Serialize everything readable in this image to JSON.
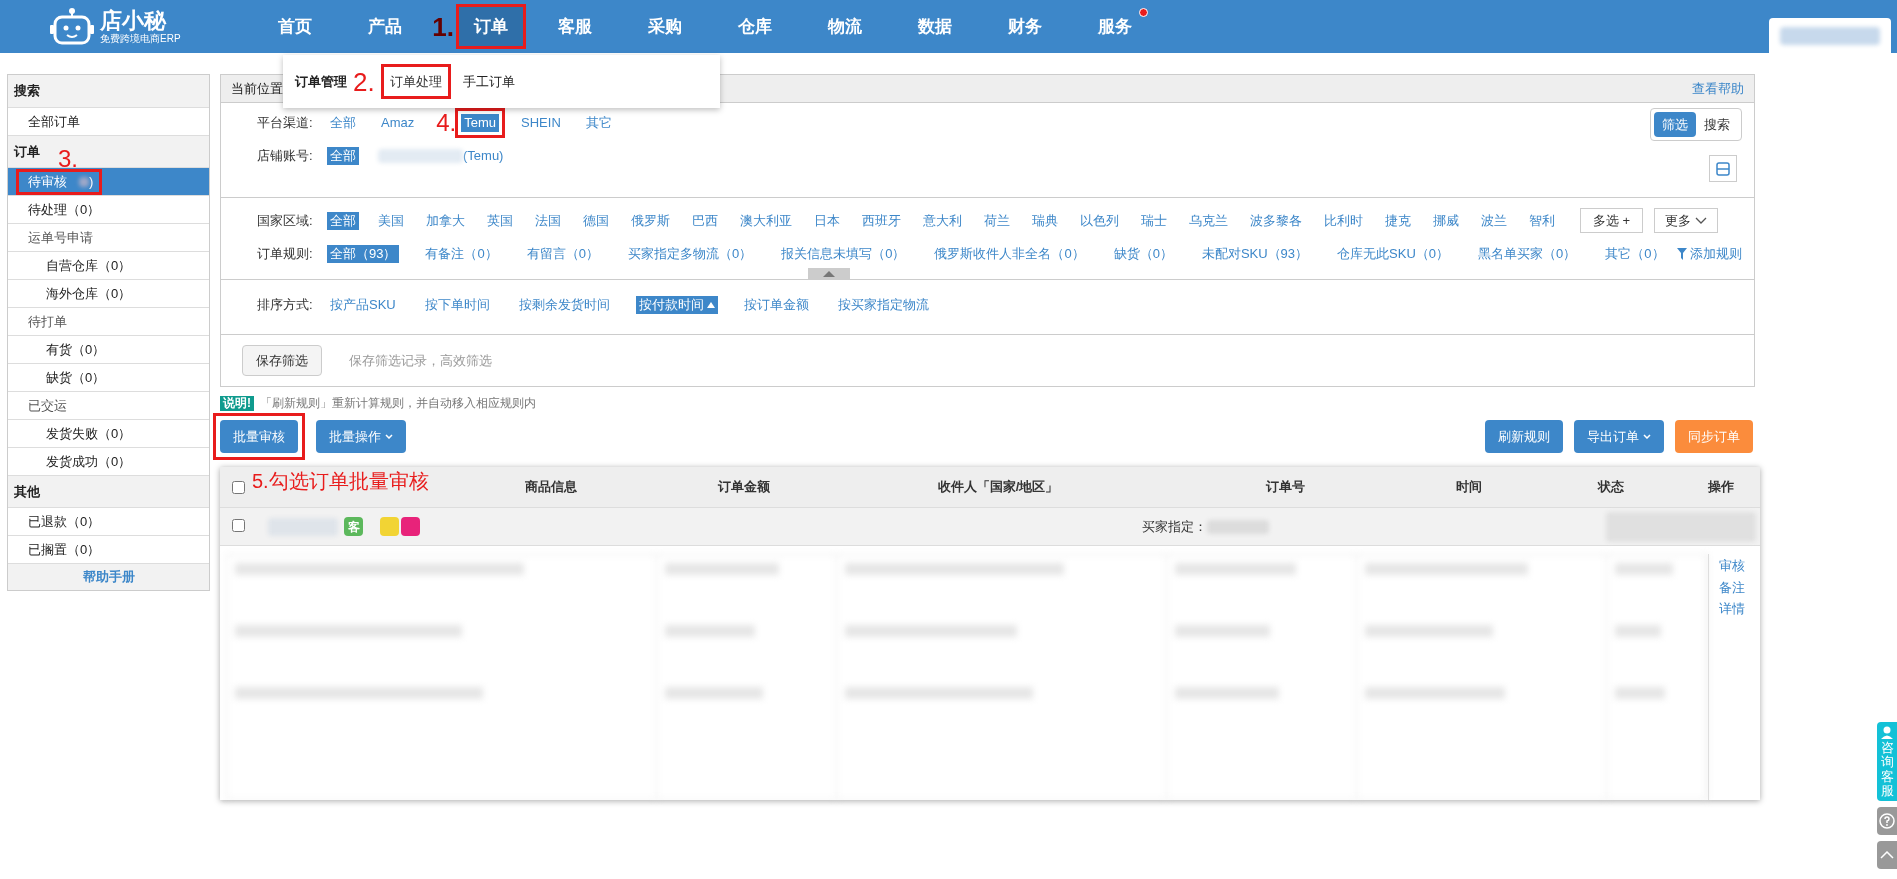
{
  "header": {
    "logo": {
      "name": "店小秘",
      "tagline": "免费跨境电商ERP"
    },
    "nav": [
      {
        "label": "首页",
        "selected": false,
        "dot": false
      },
      {
        "label": "产品",
        "selected": false,
        "dot": false
      },
      {
        "label": "订单",
        "selected": true,
        "dot": false,
        "annotation": "1."
      },
      {
        "label": "客服",
        "selected": false,
        "dot": false
      },
      {
        "label": "采购",
        "selected": false,
        "dot": false
      },
      {
        "label": "仓库",
        "selected": false,
        "dot": false
      },
      {
        "label": "物流",
        "selected": false,
        "dot": false
      },
      {
        "label": "数据",
        "selected": false,
        "dot": false
      },
      {
        "label": "财务",
        "selected": false,
        "dot": false
      },
      {
        "label": "服务",
        "selected": false,
        "dot": true
      }
    ]
  },
  "dropdown": {
    "title": "订单管理",
    "items": [
      {
        "label": "订单处理",
        "selected": true,
        "annotation": "2."
      },
      {
        "label": "手工订单",
        "selected": false
      }
    ]
  },
  "sidebar": {
    "sections": [
      {
        "title": "搜索",
        "items": [
          {
            "label": "全部订单",
            "selected": false
          }
        ]
      },
      {
        "title": "订单",
        "annotation": "3.",
        "items": [
          {
            "label": "待审核",
            "tail": ")",
            "count_hidden": true,
            "selected": true,
            "annotated": true
          },
          {
            "label": "待处理（0）",
            "selected": false
          },
          {
            "label": "运单号申请",
            "selected": false,
            "children": [
              {
                "label": "自营仓库（0）",
                "selected": false
              },
              {
                "label": "海外仓库（0）",
                "selected": false
              }
            ]
          },
          {
            "label": "待打单",
            "selected": false,
            "children": [
              {
                "label": "有货（0）",
                "selected": false
              },
              {
                "label": "缺货（0）",
                "selected": false
              }
            ]
          },
          {
            "label": "已交运",
            "selected": false,
            "children": [
              {
                "label": "发货失败（0）",
                "selected": false
              },
              {
                "label": "发货成功（0）",
                "selected": false
              }
            ]
          }
        ]
      },
      {
        "title": "其他",
        "items": [
          {
            "label": "已退款（0）",
            "selected": false
          },
          {
            "label": "已搁置（0）",
            "selected": false
          }
        ]
      }
    ],
    "footer": "帮助手册"
  },
  "panel": {
    "breadcrumb": "当前位置",
    "help": "查看帮助",
    "view_toggle": [
      {
        "label": "筛选",
        "selected": true
      },
      {
        "label": "搜索",
        "selected": false
      }
    ],
    "platform": {
      "label": "平台渠道:",
      "annotation": "4.",
      "options": [
        {
          "label": "全部",
          "selected": false
        },
        {
          "label": "Amaz",
          "selected": false
        },
        {
          "label": "Temu",
          "selected": true,
          "annotated": true
        },
        {
          "label": "SHEIN",
          "selected": false
        },
        {
          "label": "其它",
          "selected": false
        }
      ]
    },
    "store": {
      "label": "店铺账号:",
      "options": [
        {
          "label": "全部",
          "selected": true
        }
      ],
      "account_suffix": "(Temu)"
    },
    "country": {
      "label": "国家区域:",
      "options": [
        {
          "label": "全部",
          "selected": true
        },
        {
          "label": "美国",
          "selected": false
        },
        {
          "label": "加拿大",
          "selected": false
        },
        {
          "label": "英国",
          "selected": false
        },
        {
          "label": "法国",
          "selected": false
        },
        {
          "label": "德国",
          "selected": false
        },
        {
          "label": "俄罗斯",
          "selected": false
        },
        {
          "label": "巴西",
          "selected": false
        },
        {
          "label": "澳大利亚",
          "selected": false
        },
        {
          "label": "日本",
          "selected": false
        },
        {
          "label": "西班牙",
          "selected": false
        },
        {
          "label": "意大利",
          "selected": false
        },
        {
          "label": "荷兰",
          "selected": false
        },
        {
          "label": "瑞典",
          "selected": false
        },
        {
          "label": "以色列",
          "selected": false
        },
        {
          "label": "瑞士",
          "selected": false
        },
        {
          "label": "乌克兰",
          "selected": false
        },
        {
          "label": "波多黎各",
          "selected": false
        },
        {
          "label": "比利时",
          "selected": false
        },
        {
          "label": "捷克",
          "selected": false
        },
        {
          "label": "挪威",
          "selected": false
        },
        {
          "label": "波兰",
          "selected": false
        },
        {
          "label": "智利",
          "selected": false
        }
      ],
      "multi": "多选 +",
      "more": "更多"
    },
    "rules": {
      "label": "订单规则:",
      "options": [
        {
          "label": "全部（93）",
          "selected": true
        },
        {
          "label": "有备注（0）",
          "selected": false
        },
        {
          "label": "有留言（0）",
          "selected": false
        },
        {
          "label": "买家指定多物流（0）",
          "selected": false
        },
        {
          "label": "报关信息未填写（0）",
          "selected": false
        },
        {
          "label": "俄罗斯收件人非全名（0）",
          "selected": false
        },
        {
          "label": "缺货（0）",
          "selected": false
        },
        {
          "label": "未配对SKU（93）",
          "selected": false
        },
        {
          "label": "仓库无此SKU（0）",
          "selected": false
        },
        {
          "label": "黑名单买家（0）",
          "selected": false
        },
        {
          "label": "其它（0）",
          "selected": false
        }
      ],
      "add": "添加规则"
    },
    "sort": {
      "label": "排序方式:",
      "options": [
        {
          "label": "按产品SKU",
          "selected": false
        },
        {
          "label": "按下单时间",
          "selected": false
        },
        {
          "label": "按剩余发货时间",
          "selected": false
        },
        {
          "label": "按付款时间",
          "selected": true
        },
        {
          "label": "按订单金额",
          "selected": false
        },
        {
          "label": "按买家指定物流",
          "selected": false
        }
      ]
    },
    "save": {
      "button": "保存筛选",
      "hint": "保存筛选记录，高效筛选"
    }
  },
  "notice": {
    "badge": "说明!",
    "text": "「刷新规则」重新计算规则，并自动移入相应规则内"
  },
  "toolbar": {
    "left": [
      {
        "label": "批量审核",
        "kind": "plain",
        "annotated": true
      },
      {
        "label": "批量操作",
        "kind": "menu"
      }
    ],
    "right": [
      {
        "label": "刷新规则",
        "kind": "plain",
        "color": "#3d87c9"
      },
      {
        "label": "导出订单",
        "kind": "menu",
        "color": "#3d87c9"
      },
      {
        "label": "同步订单",
        "kind": "plain",
        "color": "#fb8c3c"
      }
    ]
  },
  "table": {
    "annotation": "5.勾选订单批量审核",
    "all_checked": false,
    "columns": [
      "商品信息",
      "订单金额",
      "收件人「国家/地区」",
      "订单号",
      "时间",
      "状态",
      "操作"
    ],
    "group": {
      "checked": false,
      "badge": "客",
      "tags": [
        {
          "color": "#f2d434"
        },
        {
          "color": "#e8237a"
        }
      ],
      "buyer_label": "买家指定："
    },
    "actions": [
      "审核",
      "备注",
      "详情"
    ]
  },
  "float": {
    "service": "咨询客服"
  }
}
